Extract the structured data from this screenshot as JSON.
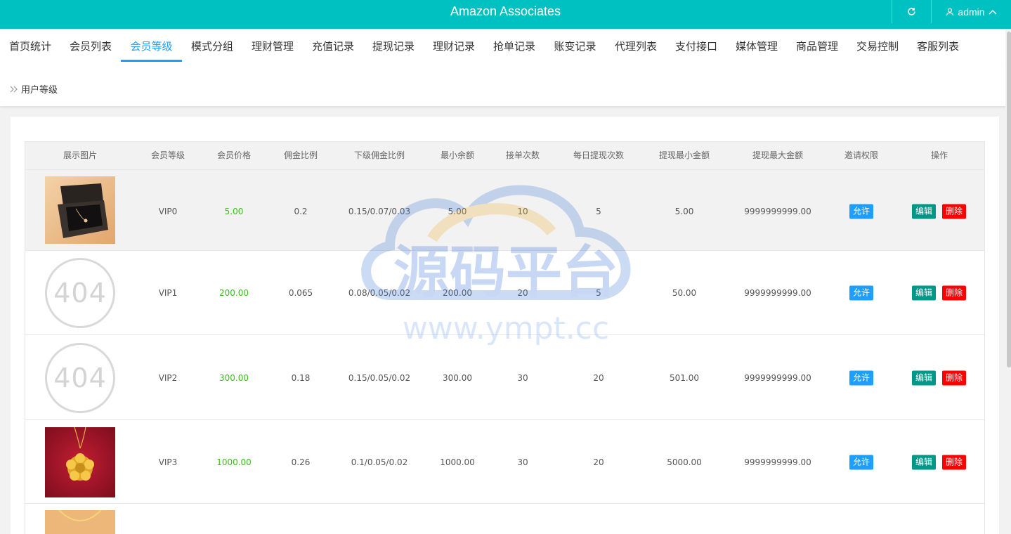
{
  "header": {
    "title": "Amazon Associates",
    "user": "admin"
  },
  "nav": [
    {
      "label": "首页统计",
      "active": false
    },
    {
      "label": "会员列表",
      "active": false
    },
    {
      "label": "会员等级",
      "active": true
    },
    {
      "label": "模式分组",
      "active": false
    },
    {
      "label": "理财管理",
      "active": false
    },
    {
      "label": "充值记录",
      "active": false
    },
    {
      "label": "提现记录",
      "active": false
    },
    {
      "label": "理财记录",
      "active": false
    },
    {
      "label": "抢单记录",
      "active": false
    },
    {
      "label": "账变记录",
      "active": false
    },
    {
      "label": "代理列表",
      "active": false
    },
    {
      "label": "支付接口",
      "active": false
    },
    {
      "label": "媒体管理",
      "active": false
    },
    {
      "label": "商品管理",
      "active": false
    },
    {
      "label": "交易控制",
      "active": false
    },
    {
      "label": "客服列表",
      "active": false
    }
  ],
  "breadcrumb": "用户等级",
  "table": {
    "columns": [
      "展示图片",
      "会员等级",
      "会员价格",
      "佣金比例",
      "下级佣金比例",
      "最小余额",
      "接单次数",
      "每日提现次数",
      "提现最小金额",
      "提现最大金额",
      "邀请权限",
      "操作"
    ],
    "rows": [
      {
        "image": "jewelry-box",
        "level": "VIP0",
        "price": "5.00",
        "commission": "0.2",
        "sub_commission": "0.15/0.07/0.03",
        "min_balance": "5.00",
        "orders": "10",
        "daily_withdraw": "5",
        "withdraw_min": "5.00",
        "withdraw_max": "9999999999.00",
        "invite": "允许",
        "edit": "编辑",
        "delete": "删除"
      },
      {
        "image": "404",
        "image_text": "404",
        "level": "VIP1",
        "price": "200.00",
        "commission": "0.065",
        "sub_commission": "0.08/0.05/0.02",
        "min_balance": "200.00",
        "orders": "20",
        "daily_withdraw": "5",
        "withdraw_min": "50.00",
        "withdraw_max": "9999999999.00",
        "invite": "允许",
        "edit": "编辑",
        "delete": "删除"
      },
      {
        "image": "404",
        "image_text": "404",
        "level": "VIP2",
        "price": "300.00",
        "commission": "0.18",
        "sub_commission": "0.15/0.05/0.02",
        "min_balance": "300.00",
        "orders": "30",
        "daily_withdraw": "20",
        "withdraw_min": "501.00",
        "withdraw_max": "9999999999.00",
        "invite": "允许",
        "edit": "编辑",
        "delete": "删除"
      },
      {
        "image": "gold-pendant",
        "level": "VIP3",
        "price": "1000.00",
        "commission": "0.26",
        "sub_commission": "0.1/0.05/0.02",
        "min_balance": "1000.00",
        "orders": "30",
        "daily_withdraw": "20",
        "withdraw_min": "5000.00",
        "withdraw_max": "9999999999.00",
        "invite": "允许",
        "edit": "编辑",
        "delete": "删除"
      },
      {
        "image": "gold-chain"
      }
    ]
  },
  "watermark": {
    "text": "源码平台",
    "url": "www.ympt.cc"
  },
  "colors": {
    "header": "#00c1c1",
    "active": "#1e9fff",
    "price": "#3bbd1a",
    "edit": "#009688",
    "delete": "#ff0000",
    "invite": "#1e9fff"
  }
}
